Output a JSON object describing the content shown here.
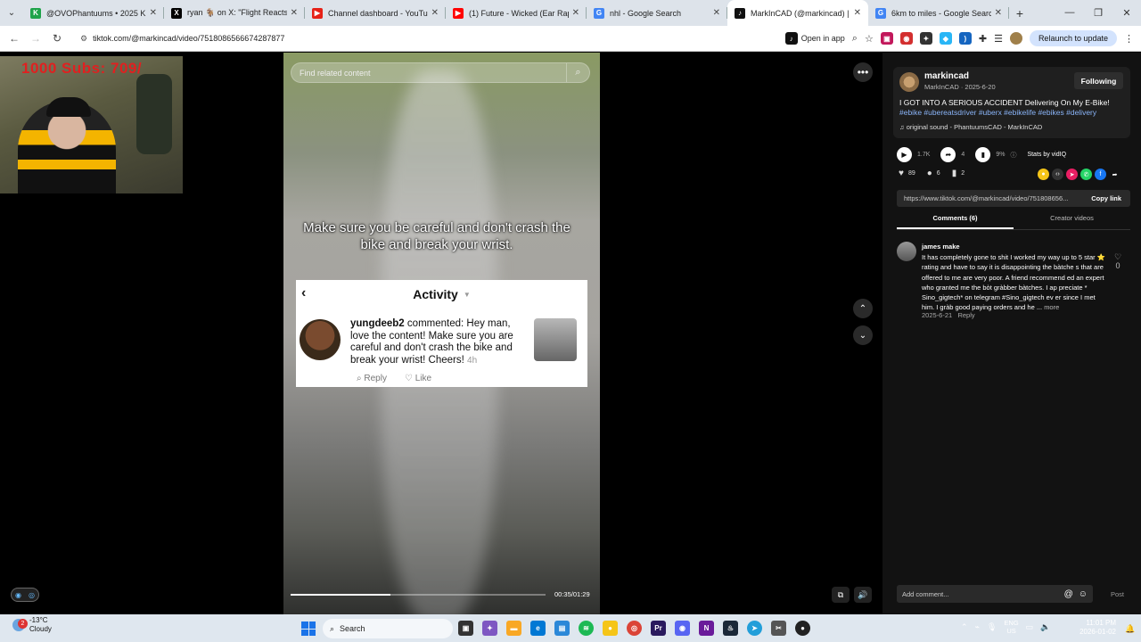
{
  "browser": {
    "tabs": [
      {
        "title": "@OVOPhantuums • 2025 KICK",
        "icon": "kick-icon",
        "color": "#1fa34a",
        "glyph": "K"
      },
      {
        "title": "ryan 🐐 on X: \"Flight Reacts is c",
        "icon": "x-icon",
        "color": "#000000",
        "glyph": "X"
      },
      {
        "title": "Channel dashboard - YouTube",
        "icon": "youtube-studio-icon",
        "color": "#e62117",
        "glyph": "▶"
      },
      {
        "title": "(1) Future - Wicked (Ear Rape)",
        "icon": "youtube-icon",
        "color": "#ff0000",
        "glyph": "▶"
      },
      {
        "title": "nhl - Google Search",
        "icon": "google-icon",
        "color": "#4285f4",
        "glyph": "G"
      },
      {
        "title": "MarkInCAD (@markincad) | Tik",
        "icon": "tiktok-icon",
        "color": "#111111",
        "glyph": "♪",
        "active": true
      },
      {
        "title": "6km to miles - Google Search",
        "icon": "google-icon",
        "color": "#4285f4",
        "glyph": "G"
      }
    ],
    "url": "tiktok.com/@markincad/video/7518086566674287877",
    "open_in_app": "Open in app",
    "relaunch": "Relaunch to update"
  },
  "webcam": {
    "subs_text": "1000  Subs: 709/"
  },
  "video": {
    "search_placeholder": "Find related content",
    "subtitle": "Make sure you be careful and don't crash the bike and break your wrist.",
    "time": "00:35/01:29",
    "progress_fraction": 0.39
  },
  "activity": {
    "title": "Activity",
    "username": "yungdeeb2",
    "comment": "commented: Hey man, love the content! Make sure you are careful and don't crash the bike and break your wrist! Cheers!",
    "time": "4h",
    "reply": "Reply",
    "like": "Like"
  },
  "panel": {
    "username": "markincad",
    "meta": "MarkInCAD · 2025-6-20",
    "follow": "Following",
    "title": "I GOT INTO A SERIOUS ACCIDENT Delivering On My E-Bike!",
    "hashtags": "#ebike #ubereatsdriver #uberx #ebikelife #ebikes #delivery",
    "sound": "original sound - PhantuumsCAD - MarkInCAD",
    "views": "1.7K",
    "shares_count": "4",
    "percent": "9%",
    "stats_by": "Stats by vidIQ",
    "likes": "89",
    "comments": "6",
    "saves": "2",
    "link": "https://www.tiktok.com/@markincad/video/751808656...",
    "copy_link": "Copy link",
    "tab_comments": "Comments (6)",
    "tab_creator": "Creator videos",
    "add_comment": "Add comment...",
    "post": "Post"
  },
  "comment": {
    "name": "james make",
    "text": "It has completely gone to shit I worked my way up to 5 star ⭐ rating and have to say it is disappointing the bàtche s that are offered to me are very poor. A friend recommend ed an expert who granted me the bòt gràbber bàtches. I ap preciate * Sino_gigtech* on telegram #Sino_gigtech ev er since I met him. I gràb good paying orders and he ...",
    "more": "more",
    "date": "2025-6-21",
    "reply": "Reply",
    "likes": "0"
  },
  "taskbar": {
    "weather_temp": "-13°C",
    "weather_desc": "Cloudy",
    "notif_count": "2",
    "search": "Search",
    "lang1": "ENG",
    "lang2": "US",
    "time": "11:01 PM",
    "date": "2026-01-02"
  }
}
